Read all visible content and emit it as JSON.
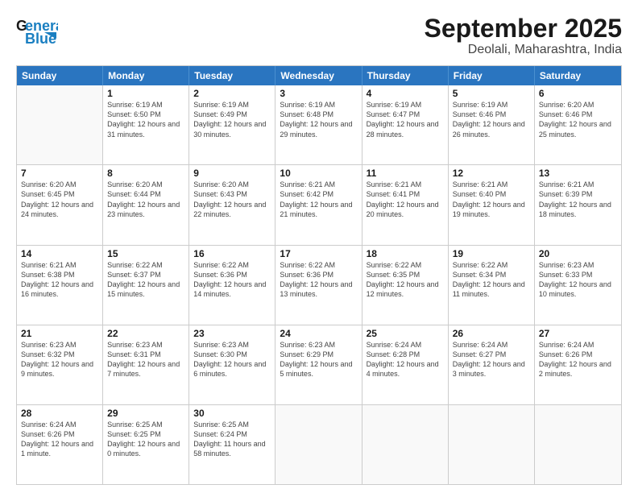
{
  "header": {
    "logo_general": "General",
    "logo_blue": "Blue",
    "title": "September 2025",
    "subtitle": "Deolali, Maharashtra, India"
  },
  "days_of_week": [
    "Sunday",
    "Monday",
    "Tuesday",
    "Wednesday",
    "Thursday",
    "Friday",
    "Saturday"
  ],
  "weeks": [
    [
      {
        "day": "",
        "empty": true
      },
      {
        "day": "1",
        "sunrise": "Sunrise: 6:19 AM",
        "sunset": "Sunset: 6:50 PM",
        "daylight": "Daylight: 12 hours and 31 minutes."
      },
      {
        "day": "2",
        "sunrise": "Sunrise: 6:19 AM",
        "sunset": "Sunset: 6:49 PM",
        "daylight": "Daylight: 12 hours and 30 minutes."
      },
      {
        "day": "3",
        "sunrise": "Sunrise: 6:19 AM",
        "sunset": "Sunset: 6:48 PM",
        "daylight": "Daylight: 12 hours and 29 minutes."
      },
      {
        "day": "4",
        "sunrise": "Sunrise: 6:19 AM",
        "sunset": "Sunset: 6:47 PM",
        "daylight": "Daylight: 12 hours and 28 minutes."
      },
      {
        "day": "5",
        "sunrise": "Sunrise: 6:19 AM",
        "sunset": "Sunset: 6:46 PM",
        "daylight": "Daylight: 12 hours and 26 minutes."
      },
      {
        "day": "6",
        "sunrise": "Sunrise: 6:20 AM",
        "sunset": "Sunset: 6:46 PM",
        "daylight": "Daylight: 12 hours and 25 minutes."
      }
    ],
    [
      {
        "day": "7",
        "sunrise": "Sunrise: 6:20 AM",
        "sunset": "Sunset: 6:45 PM",
        "daylight": "Daylight: 12 hours and 24 minutes."
      },
      {
        "day": "8",
        "sunrise": "Sunrise: 6:20 AM",
        "sunset": "Sunset: 6:44 PM",
        "daylight": "Daylight: 12 hours and 23 minutes."
      },
      {
        "day": "9",
        "sunrise": "Sunrise: 6:20 AM",
        "sunset": "Sunset: 6:43 PM",
        "daylight": "Daylight: 12 hours and 22 minutes."
      },
      {
        "day": "10",
        "sunrise": "Sunrise: 6:21 AM",
        "sunset": "Sunset: 6:42 PM",
        "daylight": "Daylight: 12 hours and 21 minutes."
      },
      {
        "day": "11",
        "sunrise": "Sunrise: 6:21 AM",
        "sunset": "Sunset: 6:41 PM",
        "daylight": "Daylight: 12 hours and 20 minutes."
      },
      {
        "day": "12",
        "sunrise": "Sunrise: 6:21 AM",
        "sunset": "Sunset: 6:40 PM",
        "daylight": "Daylight: 12 hours and 19 minutes."
      },
      {
        "day": "13",
        "sunrise": "Sunrise: 6:21 AM",
        "sunset": "Sunset: 6:39 PM",
        "daylight": "Daylight: 12 hours and 18 minutes."
      }
    ],
    [
      {
        "day": "14",
        "sunrise": "Sunrise: 6:21 AM",
        "sunset": "Sunset: 6:38 PM",
        "daylight": "Daylight: 12 hours and 16 minutes."
      },
      {
        "day": "15",
        "sunrise": "Sunrise: 6:22 AM",
        "sunset": "Sunset: 6:37 PM",
        "daylight": "Daylight: 12 hours and 15 minutes."
      },
      {
        "day": "16",
        "sunrise": "Sunrise: 6:22 AM",
        "sunset": "Sunset: 6:36 PM",
        "daylight": "Daylight: 12 hours and 14 minutes."
      },
      {
        "day": "17",
        "sunrise": "Sunrise: 6:22 AM",
        "sunset": "Sunset: 6:36 PM",
        "daylight": "Daylight: 12 hours and 13 minutes."
      },
      {
        "day": "18",
        "sunrise": "Sunrise: 6:22 AM",
        "sunset": "Sunset: 6:35 PM",
        "daylight": "Daylight: 12 hours and 12 minutes."
      },
      {
        "day": "19",
        "sunrise": "Sunrise: 6:22 AM",
        "sunset": "Sunset: 6:34 PM",
        "daylight": "Daylight: 12 hours and 11 minutes."
      },
      {
        "day": "20",
        "sunrise": "Sunrise: 6:23 AM",
        "sunset": "Sunset: 6:33 PM",
        "daylight": "Daylight: 12 hours and 10 minutes."
      }
    ],
    [
      {
        "day": "21",
        "sunrise": "Sunrise: 6:23 AM",
        "sunset": "Sunset: 6:32 PM",
        "daylight": "Daylight: 12 hours and 9 minutes."
      },
      {
        "day": "22",
        "sunrise": "Sunrise: 6:23 AM",
        "sunset": "Sunset: 6:31 PM",
        "daylight": "Daylight: 12 hours and 7 minutes."
      },
      {
        "day": "23",
        "sunrise": "Sunrise: 6:23 AM",
        "sunset": "Sunset: 6:30 PM",
        "daylight": "Daylight: 12 hours and 6 minutes."
      },
      {
        "day": "24",
        "sunrise": "Sunrise: 6:23 AM",
        "sunset": "Sunset: 6:29 PM",
        "daylight": "Daylight: 12 hours and 5 minutes."
      },
      {
        "day": "25",
        "sunrise": "Sunrise: 6:24 AM",
        "sunset": "Sunset: 6:28 PM",
        "daylight": "Daylight: 12 hours and 4 minutes."
      },
      {
        "day": "26",
        "sunrise": "Sunrise: 6:24 AM",
        "sunset": "Sunset: 6:27 PM",
        "daylight": "Daylight: 12 hours and 3 minutes."
      },
      {
        "day": "27",
        "sunrise": "Sunrise: 6:24 AM",
        "sunset": "Sunset: 6:26 PM",
        "daylight": "Daylight: 12 hours and 2 minutes."
      }
    ],
    [
      {
        "day": "28",
        "sunrise": "Sunrise: 6:24 AM",
        "sunset": "Sunset: 6:26 PM",
        "daylight": "Daylight: 12 hours and 1 minute."
      },
      {
        "day": "29",
        "sunrise": "Sunrise: 6:25 AM",
        "sunset": "Sunset: 6:25 PM",
        "daylight": "Daylight: 12 hours and 0 minutes."
      },
      {
        "day": "30",
        "sunrise": "Sunrise: 6:25 AM",
        "sunset": "Sunset: 6:24 PM",
        "daylight": "Daylight: 11 hours and 58 minutes."
      },
      {
        "day": "",
        "empty": true
      },
      {
        "day": "",
        "empty": true
      },
      {
        "day": "",
        "empty": true
      },
      {
        "day": "",
        "empty": true
      }
    ]
  ]
}
